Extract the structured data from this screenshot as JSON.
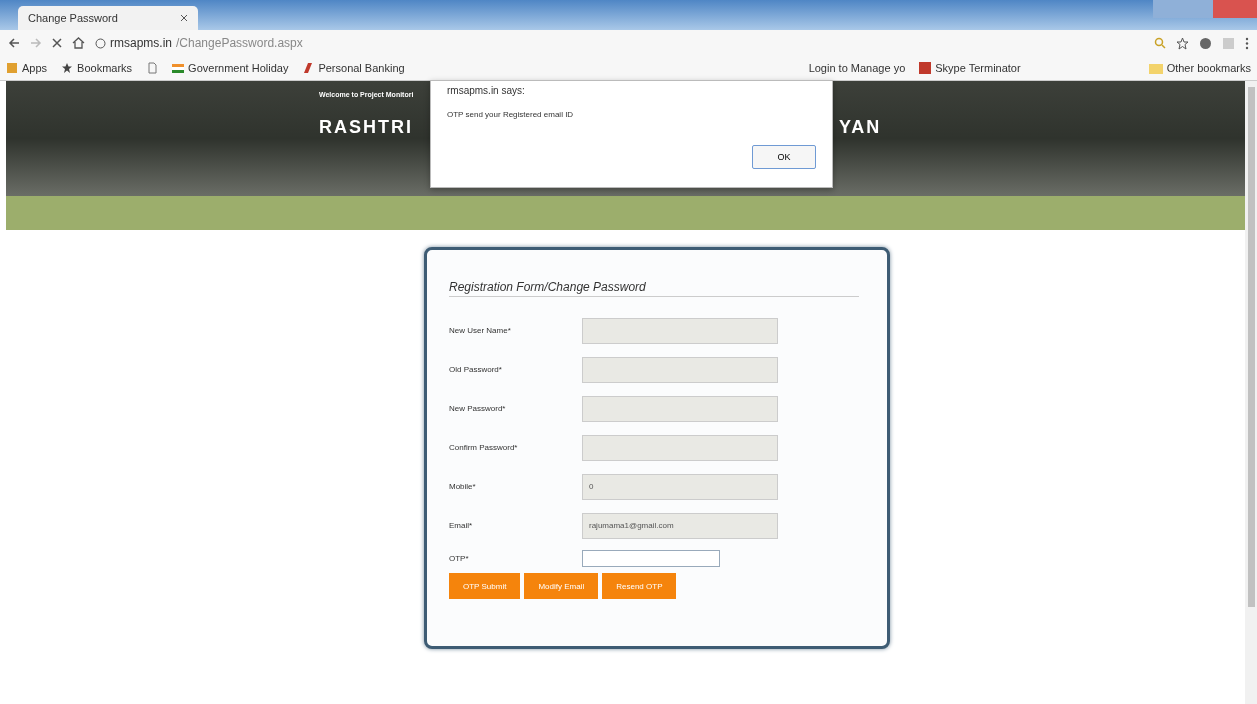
{
  "browser": {
    "tab_title": "Change Password",
    "url_host": "rmsapms.in",
    "url_path": "/ChangePassword.aspx",
    "bookmarks": [
      {
        "label": "Apps",
        "kind": "apps"
      },
      {
        "label": "Bookmarks",
        "kind": "star"
      },
      {
        "kind": "page"
      },
      {
        "label": "Government Holiday",
        "kind": "flag"
      },
      {
        "label": "Personal Banking",
        "kind": "bank"
      },
      {
        "label": "Login to Manage yo",
        "kind": "plain"
      },
      {
        "label": "Skype Terminator",
        "kind": "red"
      }
    ],
    "other_bookmarks": "Other bookmarks"
  },
  "header": {
    "welcome": "Welcome to Project Monitori",
    "title_left": "RASHTRI",
    "title_right": "YAN"
  },
  "dialog": {
    "title": "rmsapms.in says:",
    "message": "OTP send your Registered email ID",
    "ok": "OK"
  },
  "form": {
    "title": "Registration Form/Change Password",
    "fields": [
      {
        "label": "New User Name*",
        "disabled": true
      },
      {
        "label": "Old Password*",
        "disabled": true
      },
      {
        "label": "New Password*",
        "disabled": true
      },
      {
        "label": "Confirm Password*",
        "disabled": true
      },
      {
        "label": "Mobile*",
        "value": "0",
        "disabled": true
      },
      {
        "label": "Email*",
        "value": "rajumama1@gmail.com",
        "disabled": true
      },
      {
        "label": "OTP*",
        "disabled": false
      }
    ],
    "buttons": [
      "OTP Submit",
      "Modify Email",
      "Resend OTP"
    ]
  }
}
